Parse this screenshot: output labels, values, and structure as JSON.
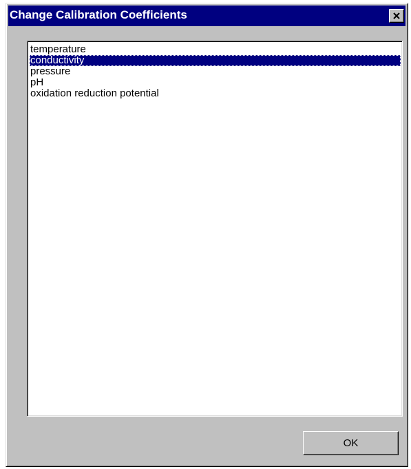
{
  "dialog": {
    "title": "Change Calibration Coefficients",
    "close_icon": "close-icon"
  },
  "list": {
    "items": [
      {
        "label": "temperature",
        "selected": false
      },
      {
        "label": "conductivity",
        "selected": true
      },
      {
        "label": "pressure",
        "selected": false
      },
      {
        "label": "pH",
        "selected": false
      },
      {
        "label": "oxidation reduction potential",
        "selected": false
      }
    ]
  },
  "buttons": {
    "ok_label": "OK"
  },
  "colors": {
    "titlebar": "#000080",
    "face": "#c0c0c0",
    "selection": "#000080"
  }
}
